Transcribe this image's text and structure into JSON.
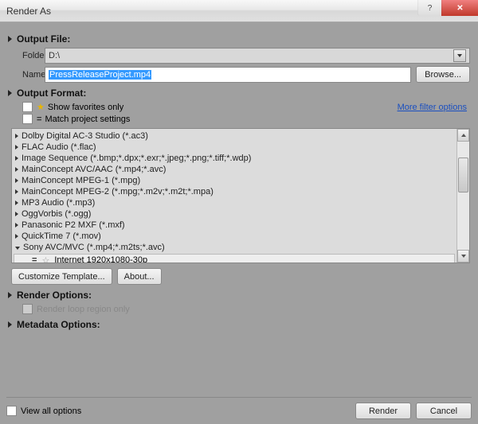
{
  "window": {
    "title": "Render As"
  },
  "outputFile": {
    "header": "Output File:",
    "folderLabel": "Folder:",
    "folderValue": "D:\\",
    "nameLabel": "Name:",
    "nameValue": "PressReleaseProject.mp4",
    "browse": "Browse..."
  },
  "outputFormat": {
    "header": "Output Format:",
    "favoritesLabel": "Show favorites only",
    "matchLabel": "Match project settings",
    "moreFilter": "More filter options",
    "items": [
      "Dolby Digital AC-3 Studio (*.ac3)",
      "FLAC Audio (*.flac)",
      "Image Sequence (*.bmp;*.dpx;*.exr;*.jpeg;*.png;*.tiff;*.wdp)",
      "MainConcept AVC/AAC (*.mp4;*.avc)",
      "MainConcept MPEG-1 (*.mpg)",
      "MainConcept MPEG-2 (*.mpg;*.m2v;*.m2t;*.mpa)",
      "MP3 Audio (*.mp3)",
      "OggVorbis (*.ogg)",
      "Panasonic P2 MXF (*.mxf)",
      "QuickTime 7 (*.mov)",
      "Sony AVC/MVC (*.mp4;*.m2ts;*.avc)"
    ],
    "expandedPreset": "Internet 1920x1080-30p",
    "customize": "Customize Template...",
    "about": "About..."
  },
  "renderOptions": {
    "header": "Render Options:",
    "loopLabel": "Render loop region only"
  },
  "metadataOptions": {
    "header": "Metadata Options:"
  },
  "footer": {
    "viewAll": "View all options",
    "render": "Render",
    "cancel": "Cancel"
  }
}
